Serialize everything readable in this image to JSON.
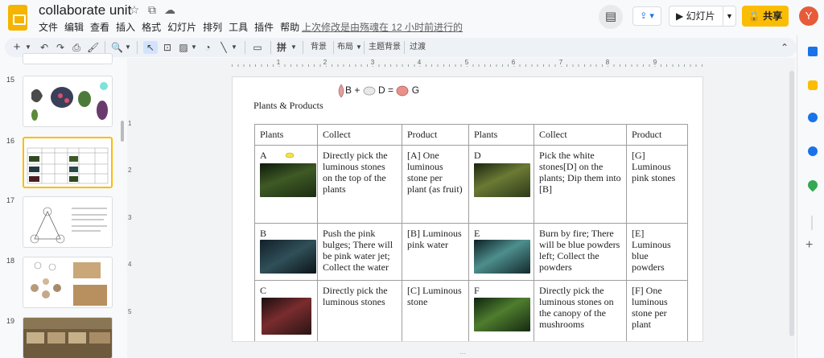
{
  "app": {
    "title": "collaborate unit",
    "menu": [
      "文件",
      "编辑",
      "查看",
      "插入",
      "格式",
      "幻灯片",
      "排列",
      "工具",
      "插件",
      "帮助"
    ],
    "last_edit": "上次修改是由殇魂在 12 小时前进行的",
    "slideshow_label": "幻灯片",
    "share_label": "共享",
    "avatar_initial": "Y"
  },
  "toolbar": {
    "add": "+",
    "zoom": "🔍",
    "background": "背景",
    "layout": "布局",
    "theme": "主题背景",
    "transition": "过渡"
  },
  "ruler": [
    "1",
    "2",
    "3",
    "4",
    "5",
    "6",
    "7",
    "8",
    "9"
  ],
  "vruler": [
    "1",
    "2",
    "3",
    "4",
    "5"
  ],
  "filmstrip": [
    {
      "num": "15"
    },
    {
      "num": "16"
    },
    {
      "num": "17"
    },
    {
      "num": "18"
    },
    {
      "num": "19"
    }
  ],
  "slide": {
    "legend": {
      "b": "B +",
      "d": "D  =",
      "g": "G"
    },
    "title": "Plants & Products",
    "headers": [
      "Plants",
      "Collect",
      "Product",
      "Plants",
      "Collect",
      "Product"
    ],
    "rows": [
      {
        "plant1": "A",
        "collect1": "Directly pick the luminous stones on the top of the plants",
        "product1": "[A] One luminous stone per plant (as fruit)",
        "plant2": "D",
        "collect2": "Pick the white stones[D] on the plants; Dip them into [B]",
        "product2": "[G] Luminous pink stones"
      },
      {
        "plant1": "B",
        "collect1": "Push the pink bulges; There will be pink water jet; Collect the water",
        "product1": "[B] Luminous pink water",
        "plant2": "E",
        "collect2": "Burn by fire; There will be blue powders left; Collect the powders",
        "product2": "[E] Luminous blue powders"
      },
      {
        "plant1": "C",
        "collect1": "Directly pick the luminous stones",
        "product1": "[C] Luminous stone",
        "plant2": "F",
        "collect2": "Directly pick the luminous stones on the canopy of the mushrooms",
        "product2": "[F] One luminous stone per plant"
      }
    ]
  },
  "colors": {
    "share": "#fbbc04",
    "accent": "#1a73e8",
    "avatar": "#e65b3a",
    "selected_thumb": "#fbbc04"
  }
}
